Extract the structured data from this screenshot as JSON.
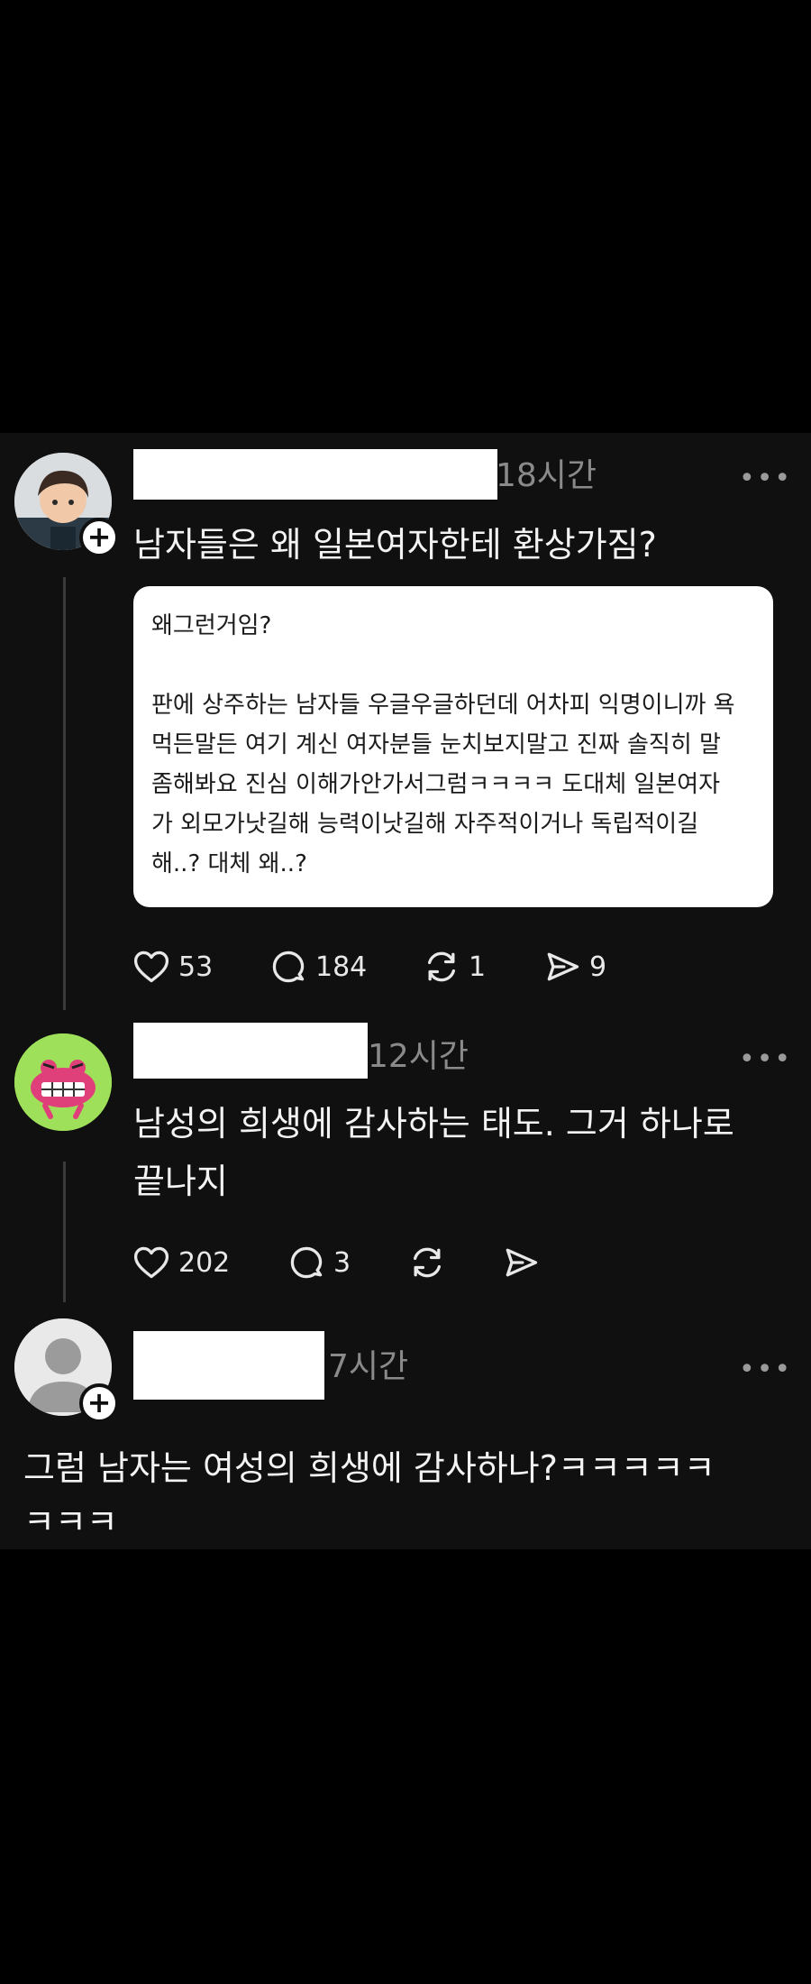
{
  "posts": [
    {
      "time": "18시간",
      "text": "남자들은 왜 일본여자한테 환상가짐?",
      "quote_title": "왜그런거임?",
      "quote_body": "판에 상주하는 남자들 우글우글하던데 어차피 익명이니까 욕\n먹든말든 여기 계신 여자분들 눈치보지말고 진짜 솔직히 말\n좀해봐요 진심 이해가안가서그럼ㅋㅋㅋㅋ 도대체 일본여자\n가 외모가낫길해 능력이낫길해 자주적이거나 독립적이길\n해..? 대체 왜..?",
      "likes": "53",
      "replies": "184",
      "reposts": "1",
      "shares": "9"
    },
    {
      "time": "12시간",
      "text_line1": "남성의 희생에 감사하는 태도. 그거 하나로",
      "text_line2": "끝나지",
      "likes": "202",
      "replies": "3"
    },
    {
      "time": "7시간",
      "text_line1": "그럼 남자는 여성의 희생에 감사하나?ㅋㅋㅋㅋㅋ",
      "text_line2": "ㅋㅋㅋ"
    }
  ],
  "more_label": "•••",
  "plus_label": "+",
  "icons": [
    "heart-icon",
    "comment-icon",
    "repost-icon",
    "share-icon",
    "more-icon",
    "follow-plus-icon"
  ]
}
